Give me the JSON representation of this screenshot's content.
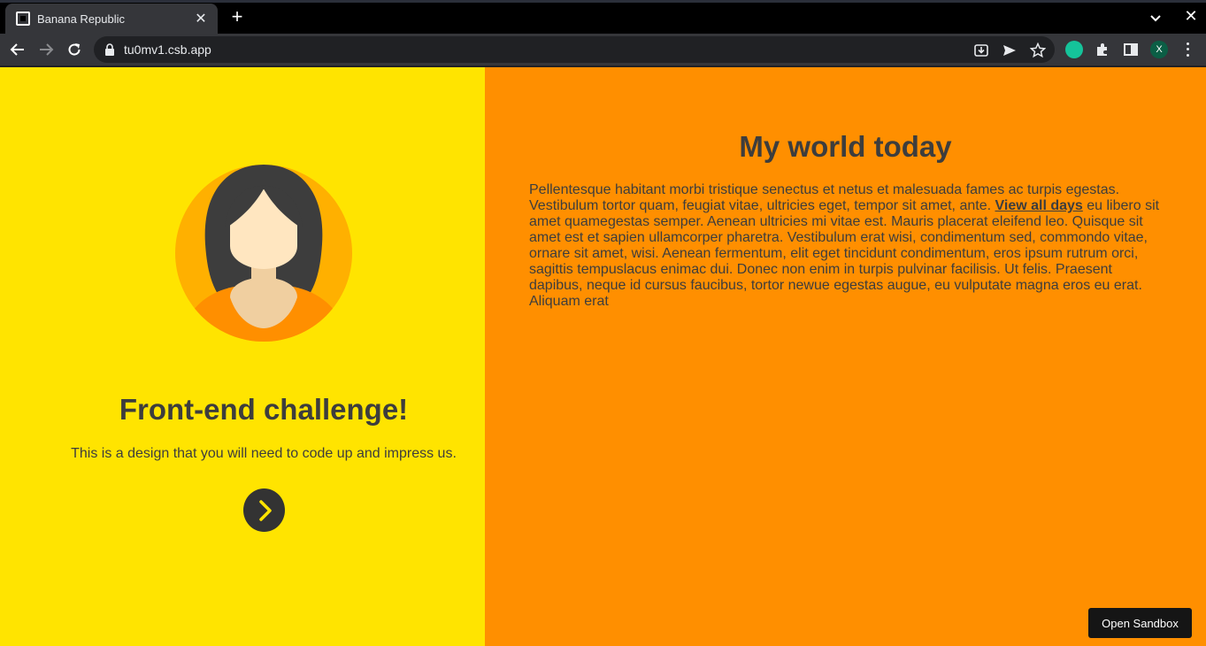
{
  "browser": {
    "tab_title": "Banana Republic",
    "tab_close": "✕",
    "new_tab": "+",
    "window_close": "✕",
    "url": "tu0mv1.csb.app",
    "profile_initial": "X"
  },
  "left": {
    "heading": "Front-end challenge!",
    "subtitle": "This is a design that you will need to code up and impress us."
  },
  "right": {
    "title": "My world today",
    "body_before_link": "Pellentesque habitant morbi tristique senectus et netus et malesuada fames ac turpis egestas. Vestibulum tortor quam, feugiat vitae, ultricies eget, tempor sit amet, ante. ",
    "link_text": "View all days",
    "body_after_link": " eu libero sit amet quamegestas semper. Aenean ultricies mi vitae est. Mauris placerat eleifend leo. Quisque sit amet est et sapien ullamcorper pharetra. Vestibulum erat wisi, condimentum sed, commondo vitae, ornare sit amet, wisi. Aenean fermentum, elit eget tincidunt condimentum, eros ipsum rutrum orci, sagittis tempuslacus enimac dui. Donec non enim in turpis pulvinar facilisis. Ut felis. Praesent dapibus, neque id cursus faucibus, tortor newue egestas augue, eu vulputate magna eros eu erat. Aliquam erat"
  },
  "sandbox_button": "Open Sandbox",
  "colors": {
    "left_bg": "#ffe400",
    "right_bg": "#ff8f00",
    "text": "#3d3d3d"
  }
}
